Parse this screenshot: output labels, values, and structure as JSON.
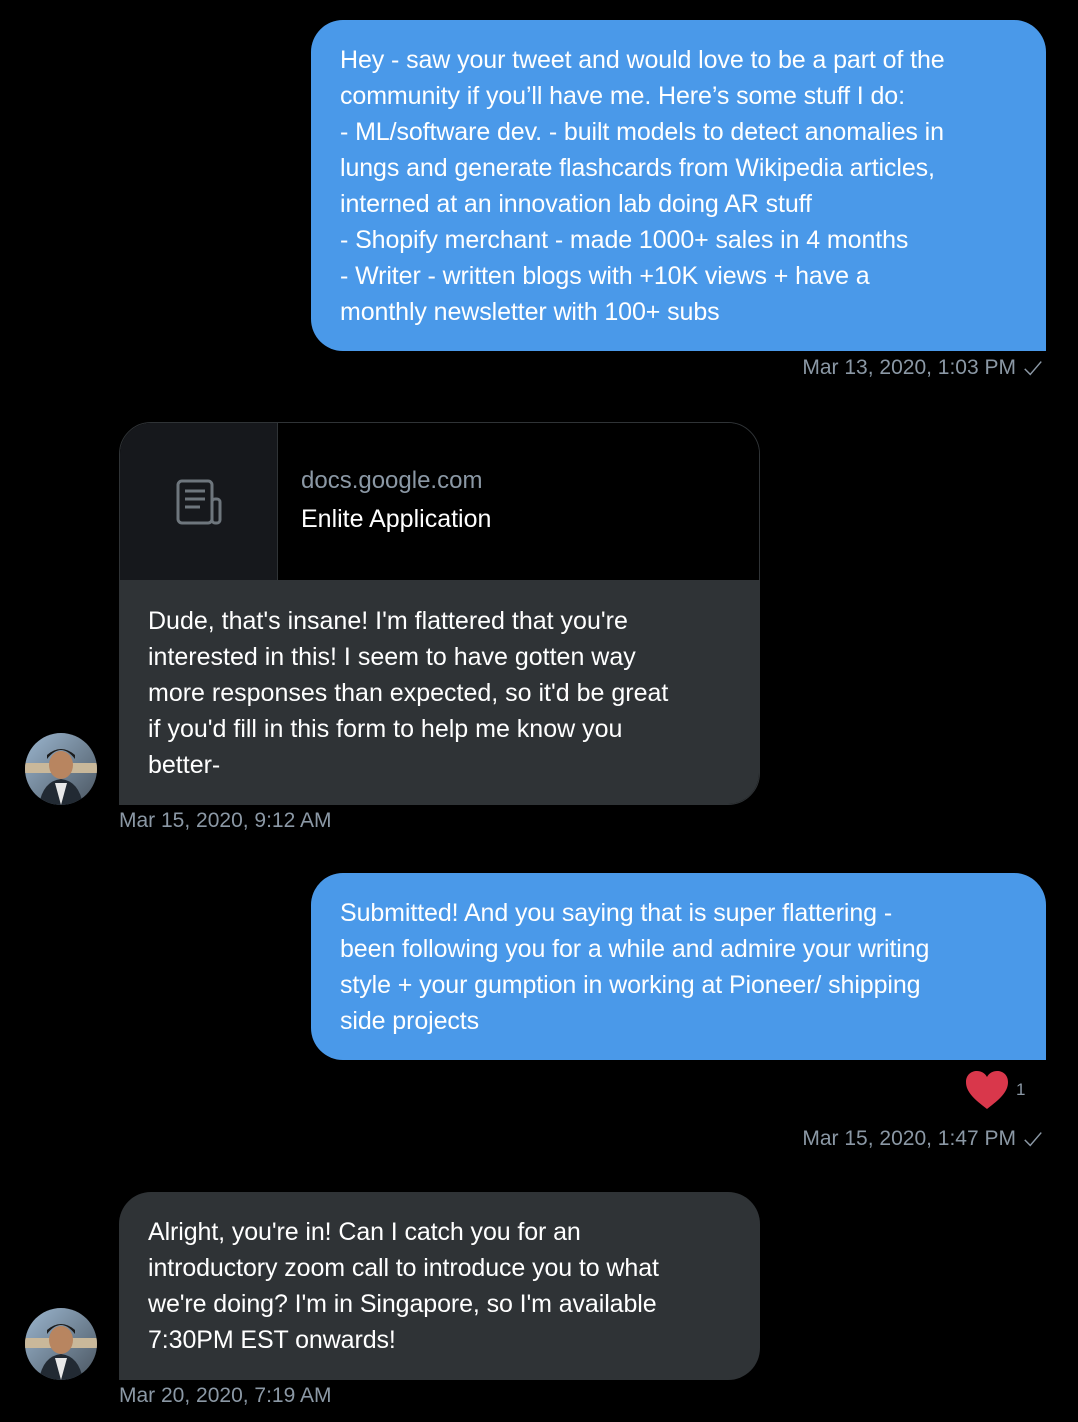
{
  "colors": {
    "background": "#000000",
    "sent_bubble": "#4a99e9",
    "received_bubble": "#2f3336",
    "meta_text": "#8b98a5",
    "heart": "#e0245e"
  },
  "messages": [
    {
      "direction": "sent",
      "text": "Hey - saw your tweet and would love to be a part of the\ncommunity if you’ll have me. Here’s some stuff I do:\n- ML/software dev. - built models to detect anomalies in\nlungs and generate flashcards from Wikipedia articles,\ninterned at an innovation lab doing AR stuff\n- Shopify merchant - made 1000+ sales in 4 months\n- Writer - written blogs with +10K views + have a\nmonthly newsletter with 100+ subs",
      "timestamp": "Mar 13, 2020, 1:03 PM",
      "status_icon": "check-icon"
    },
    {
      "direction": "received",
      "link_card": {
        "domain": "docs.google.com",
        "title": "Enlite Application",
        "icon": "document-icon"
      },
      "text": "Dude, that's insane! I'm flattered that you're\ninterested in this! I seem to have gotten way\nmore responses than expected, so it'd be great\nif you'd fill in this form to help me know you\nbetter-",
      "timestamp": "Mar 15, 2020, 9:12 AM",
      "avatar": "avatar"
    },
    {
      "direction": "sent",
      "text": "Submitted! And you saying that is super flattering -\nbeen following you for a while and admire your writing\nstyle + your gumption in working at Pioneer/ shipping\nside projects",
      "reaction": {
        "icon": "heart-icon",
        "count": "1"
      },
      "timestamp": "Mar 15, 2020, 1:47 PM",
      "status_icon": "check-icon"
    },
    {
      "direction": "received",
      "text": "Alright, you're in! Can I catch you for an\nintroductory zoom call to introduce you to what\nwe're doing? I'm in Singapore, so I'm available\n7:30PM EST onwards!",
      "timestamp": "Mar 20, 2020, 7:19 AM",
      "avatar": "avatar"
    }
  ]
}
